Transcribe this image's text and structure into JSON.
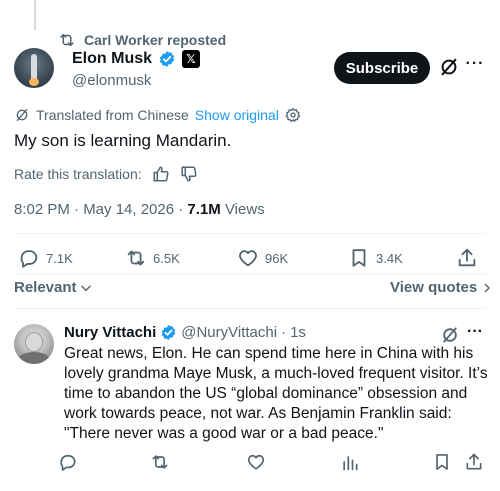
{
  "repost": {
    "label": "Carl Worker reposted"
  },
  "author": {
    "name": "Elon Musk",
    "handle": "@elonmusk"
  },
  "header": {
    "subscribe_label": "Subscribe",
    "more_label": "···"
  },
  "translation": {
    "label": "Translated from Chinese",
    "show_original": "Show original"
  },
  "tweet": {
    "text": "My son is learning Mandarin."
  },
  "rating": {
    "label": "Rate this translation:"
  },
  "meta": {
    "timestamp": "8:02 PM · May 14, 2026 · ",
    "views_count": "7.1M",
    "views_label": " Views"
  },
  "actions": {
    "replies": "7.1K",
    "reposts": "6.5K",
    "likes": "96K",
    "bookmarks": "3.4K"
  },
  "sort": {
    "label": "Relevant",
    "view_quotes": "View quotes"
  },
  "reply": {
    "name": "Nury Vittachi",
    "handle": "@NuryVittachi",
    "separator": " · ",
    "time": "1s",
    "more_label": "···",
    "text": "Great news, Elon. He can spend time here in China with his lovely grandma Maye Musk, a much-loved frequent visitor. It’s time to abandon the US “global dominance” obsession and work towards peace, not war. As Benjamin Franklin said: \"There never was a good war or a bad peace.\""
  },
  "colors": {
    "accent": "#1d9bf0",
    "text": "#0f1419",
    "muted": "#536471",
    "divider": "#eff3f4"
  }
}
